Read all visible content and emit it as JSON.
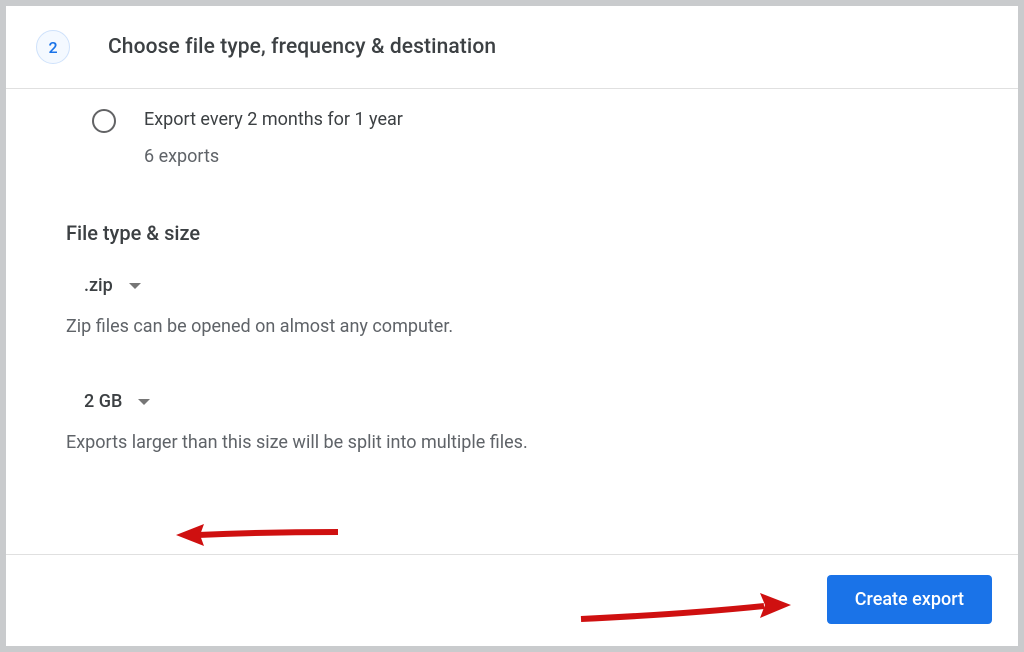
{
  "header": {
    "step_number": "2",
    "title": "Choose file type, frequency & destination"
  },
  "frequency_option": {
    "label": "Export every 2 months for 1 year",
    "sub_label": "6 exports"
  },
  "file_type_size": {
    "heading": "File type & size",
    "filetype_value": ".zip",
    "filetype_helper": "Zip files can be opened on almost any computer.",
    "size_value": "2 GB",
    "size_helper": "Exports larger than this size will be split into multiple files."
  },
  "footer": {
    "create_export": "Create export"
  }
}
